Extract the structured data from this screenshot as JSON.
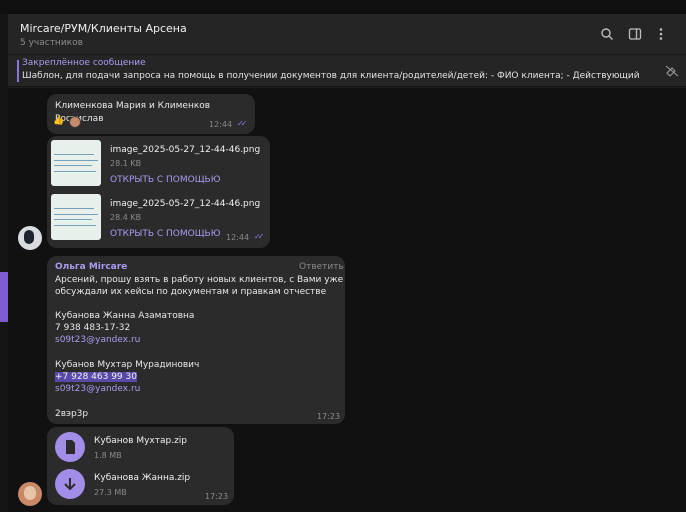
{
  "header": {
    "title": "Mircare/РУМ/Клиенты Арсена",
    "subtitle": "5 участников",
    "icons": [
      "search-icon",
      "sidebar-toggle-icon",
      "more-icon"
    ]
  },
  "pinned": {
    "title": "Закреплённое сообщение",
    "text": "Шаблон, для подачи запроса на помощь в получении документов для клиента/родителей/детей: - ФИО клиента; - Действующий клиент ил..."
  },
  "messages": {
    "m1": {
      "text": "Клименкова Мария  и Клименков Ростислав",
      "time": "12:44",
      "reaction": "👍"
    },
    "files": {
      "f1": {
        "name": "image_2025-05-27_12-44-46.png",
        "size": "28.1 KB",
        "action": "ОТКРЫТЬ С ПОМОЩЬЮ"
      },
      "f2": {
        "name": "image_2025-05-27_12-44-46.png",
        "size": "28.4 KB",
        "action": "ОТКРЫТЬ С ПОМОЩЬЮ",
        "time": "12:44"
      }
    },
    "m3": {
      "sender": "Ольга Mircare",
      "reply": "Ответить",
      "line1": "Арсений, прошу взять в работу новых клиентов, с Вами уже",
      "line2": "обсуждали их кейсы по документам и правкам отчестве",
      "c1_name": "Кубанова Жанна Азаматовна",
      "c1_phone": "7 938 483-17-32",
      "c1_email": "s09t23@yandex.ru",
      "c2_name": "Кубанов Мухтар Мурадинович",
      "c2_phone": "+7 928 463 99 30",
      "c2_email": "s09t23@yandex.ru",
      "extra": "2вэр3р",
      "time": "17:23"
    },
    "zips": {
      "z1": {
        "name": "Кубанов Мухтар.zip",
        "size": "1.8 MB"
      },
      "z2": {
        "name": "Кубанова Жанна.zip",
        "size": "27.3 MB",
        "time": "17:23"
      }
    }
  }
}
